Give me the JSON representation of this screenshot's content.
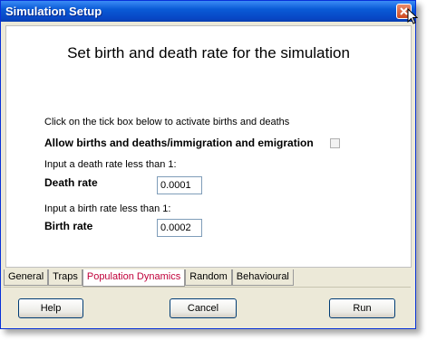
{
  "window": {
    "title": "Simulation Setup"
  },
  "main": {
    "heading": "Set birth and death rate for the simulation",
    "instruction": "Click on the tick box below to activate births and deaths",
    "allow_label": "Allow births and deaths/immigration and emigration",
    "allow_checked": false,
    "death_prompt": "Input a death rate less than 1:",
    "death_label": "Death rate",
    "death_value": "0.0001",
    "birth_prompt": "Input a birth rate less than 1:",
    "birth_label": "Birth rate",
    "birth_value": "0.0002"
  },
  "tabs": [
    {
      "label": "General"
    },
    {
      "label": "Traps"
    },
    {
      "label": "Population Dynamics",
      "active": true
    },
    {
      "label": "Random"
    },
    {
      "label": "Behavioural"
    }
  ],
  "buttons": {
    "help": "Help",
    "cancel": "Cancel",
    "run": "Run"
  },
  "icons": {
    "close": "close-icon",
    "cursor": "mouse-cursor-icon"
  },
  "colors": {
    "title_bar": "#0a5bd6",
    "active_tab_text": "#c0003a",
    "close_button": "#cf4a20"
  }
}
